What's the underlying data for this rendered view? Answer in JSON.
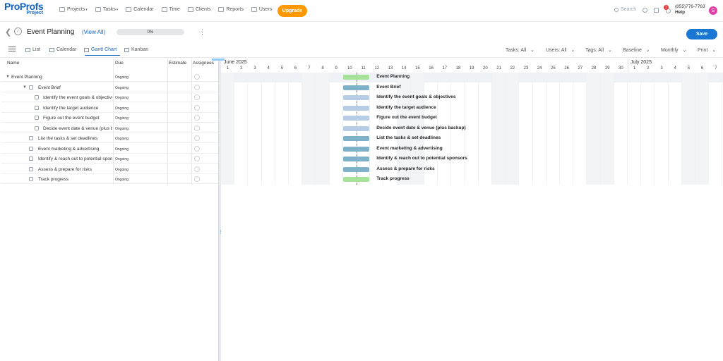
{
  "app": {
    "logo_main": "ProProfs",
    "logo_sub": "Project"
  },
  "nav": [
    {
      "label": "Projects",
      "dropdown": true
    },
    {
      "label": "Tasks",
      "dropdown": true
    },
    {
      "label": "Calendar",
      "dropdown": false
    },
    {
      "label": "Time",
      "dropdown": false
    },
    {
      "label": "Clients",
      "dropdown": false
    },
    {
      "label": "Reports",
      "dropdown": false
    },
    {
      "label": "Users",
      "dropdown": false
    }
  ],
  "upgrade_label": "Upgrade",
  "search_placeholder": "Search",
  "notifications_count": "1",
  "phone": "(855)776-7763",
  "help_label": "Help",
  "avatar_initial": "S",
  "project": {
    "title": "Event Planning",
    "view_all": "(View All)",
    "progress": "0%",
    "save_label": "Save"
  },
  "view_tabs": [
    {
      "label": "List",
      "active": false
    },
    {
      "label": "Calendar",
      "active": false
    },
    {
      "label": "Gantt Chart",
      "active": true
    },
    {
      "label": "Kanban",
      "active": false
    }
  ],
  "filters": [
    "Tasks: All",
    "Users: All",
    "Tags: All",
    "Baseline",
    "Monthly",
    "Print"
  ],
  "columns": {
    "name": "Name",
    "due": "Due",
    "estimate": "Estimate",
    "assignees": "Assignees"
  },
  "tasks": [
    {
      "name": "Event Planning",
      "due": "Ongoing",
      "level": 0,
      "type": "project",
      "bar_color": "#a6e29a"
    },
    {
      "name": "Event Brief",
      "due": "Ongoing",
      "level": 1,
      "type": "folder",
      "bar_color": "#7fb1c9"
    },
    {
      "name": "Identify the event goals & objectives",
      "due": "Ongoing",
      "level": 2,
      "type": "task",
      "bar_color": "#b7cde6"
    },
    {
      "name": "Identify the target audience",
      "due": "Ongoing",
      "level": 2,
      "type": "task",
      "bar_color": "#b7cde6"
    },
    {
      "name": "Figure out the event budget",
      "due": "Ongoing",
      "level": 2,
      "type": "task",
      "bar_color": "#b7cde6"
    },
    {
      "name": "Decide event date & venue (plus backup)",
      "due": "Ongoing",
      "level": 2,
      "type": "task",
      "bar_color": "#b7cde6"
    },
    {
      "name": "List the tasks & set deadlines",
      "due": "Ongoing",
      "level": 1,
      "type": "folder",
      "bar_color": "#7fb1c9"
    },
    {
      "name": "Event marketing & advertising",
      "due": "Ongoing",
      "level": 1,
      "type": "folder",
      "bar_color": "#7fb1c9"
    },
    {
      "name": "Identify & reach out to potential sponsors",
      "due": "Ongoing",
      "level": 1,
      "type": "folder",
      "bar_color": "#7fb1c9"
    },
    {
      "name": "Assess & prepare for risks",
      "due": "Ongoing",
      "level": 1,
      "type": "folder",
      "bar_color": "#7fb1c9"
    },
    {
      "name": "Track progress",
      "due": "Ongoing",
      "level": 1,
      "type": "folder",
      "bar_color": "#a6e29a"
    }
  ],
  "timeline": {
    "months": [
      {
        "label": "June 2025",
        "start_day": 1
      },
      {
        "label": "July 2025",
        "start_day": 1
      }
    ],
    "june_days": [
      1,
      2,
      3,
      4,
      5,
      6,
      7,
      8,
      9,
      10,
      11,
      12,
      13,
      14,
      15,
      16,
      17,
      18,
      19,
      20,
      21,
      22,
      23,
      24,
      25,
      26,
      27,
      28,
      29,
      30
    ],
    "july_days": [
      1,
      2,
      3,
      4,
      5,
      6,
      7
    ],
    "weekend_shade": "#f3f4f6",
    "bar_start_day": 10,
    "bar_end_day": 11
  }
}
